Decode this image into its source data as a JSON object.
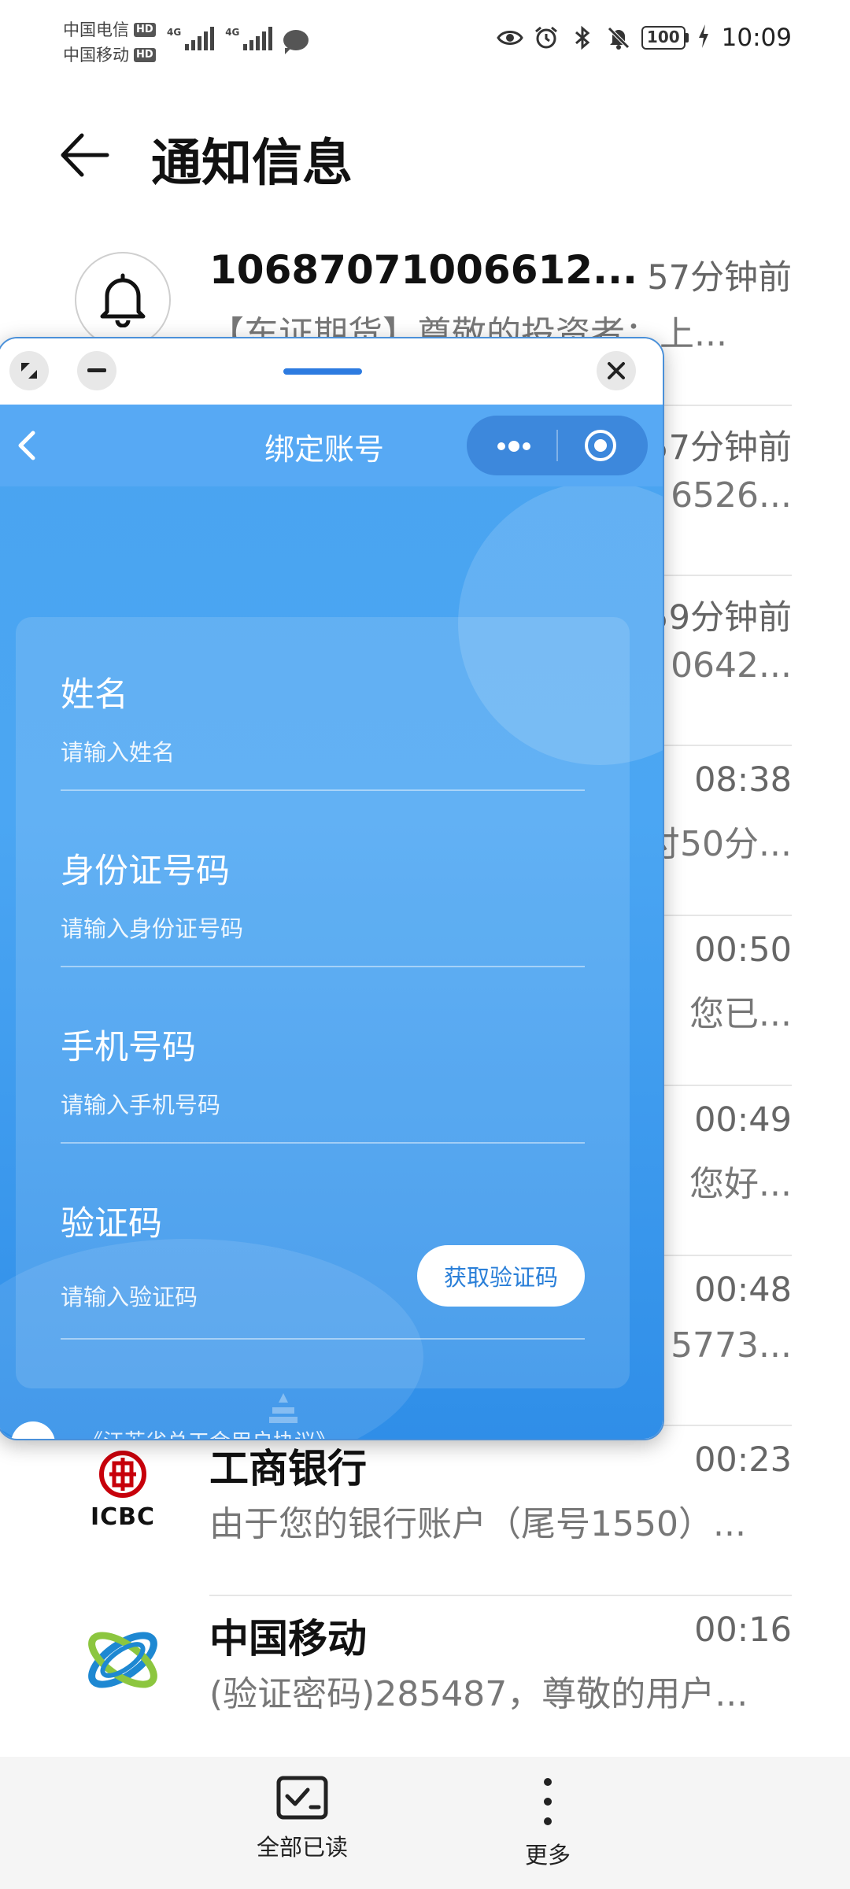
{
  "status_bar": {
    "carrier_1": "中国电信",
    "carrier_2": "中国移动",
    "hd_badge": "HD",
    "network_1": "4G",
    "network_2": "4G",
    "battery": "100",
    "time": "10:09",
    "icons": [
      "eye-icon",
      "alarm-icon",
      "bluetooth-icon",
      "mute-icon",
      "charging-icon"
    ]
  },
  "header": {
    "title": "通知信息"
  },
  "messages": [
    {
      "sender": "10687071006612...",
      "time": "57分钟前",
      "preview": "【东证期货】尊敬的投资者：上...",
      "avatar": "bell-icon"
    },
    {
      "time": "57分钟前",
      "preview_tail": "6526..."
    },
    {
      "time": "59分钟前",
      "preview_tail": "0642..."
    },
    {
      "time": "08:38",
      "preview_tail": "付50分..."
    },
    {
      "time": "00:50",
      "preview_tail": "您已..."
    },
    {
      "time": "00:49",
      "preview_tail": "您好..."
    },
    {
      "time": "00:48",
      "preview_tail": "5773..."
    },
    {
      "sender": "工商银行",
      "time": "00:23",
      "preview": "由于您的银行账户（尾号1550）...",
      "avatar": "icbc-logo",
      "logo_text": "ICBC",
      "logo_color": "#c7000b"
    },
    {
      "sender": "中国移动",
      "time": "00:16",
      "preview": "(验证密码)285487，尊敬的用户...",
      "avatar": "china-mobile-logo"
    }
  ],
  "bottom_bar": {
    "mark_all_read": "全部已读",
    "more": "更多"
  },
  "mini_app": {
    "nav_title": "绑定账号",
    "fields": [
      {
        "label": "姓名",
        "placeholder": "请输入姓名"
      },
      {
        "label": "身份证号码",
        "placeholder": "请输入身份证号码"
      },
      {
        "label": "手机号码",
        "placeholder": "请输入手机号码"
      },
      {
        "label": "验证码",
        "placeholder": "请输入验证码"
      }
    ],
    "get_code_button": "获取验证码",
    "agreement_text": "《江苏省总工会用户协议》",
    "accent_color": "#2d7be0"
  }
}
